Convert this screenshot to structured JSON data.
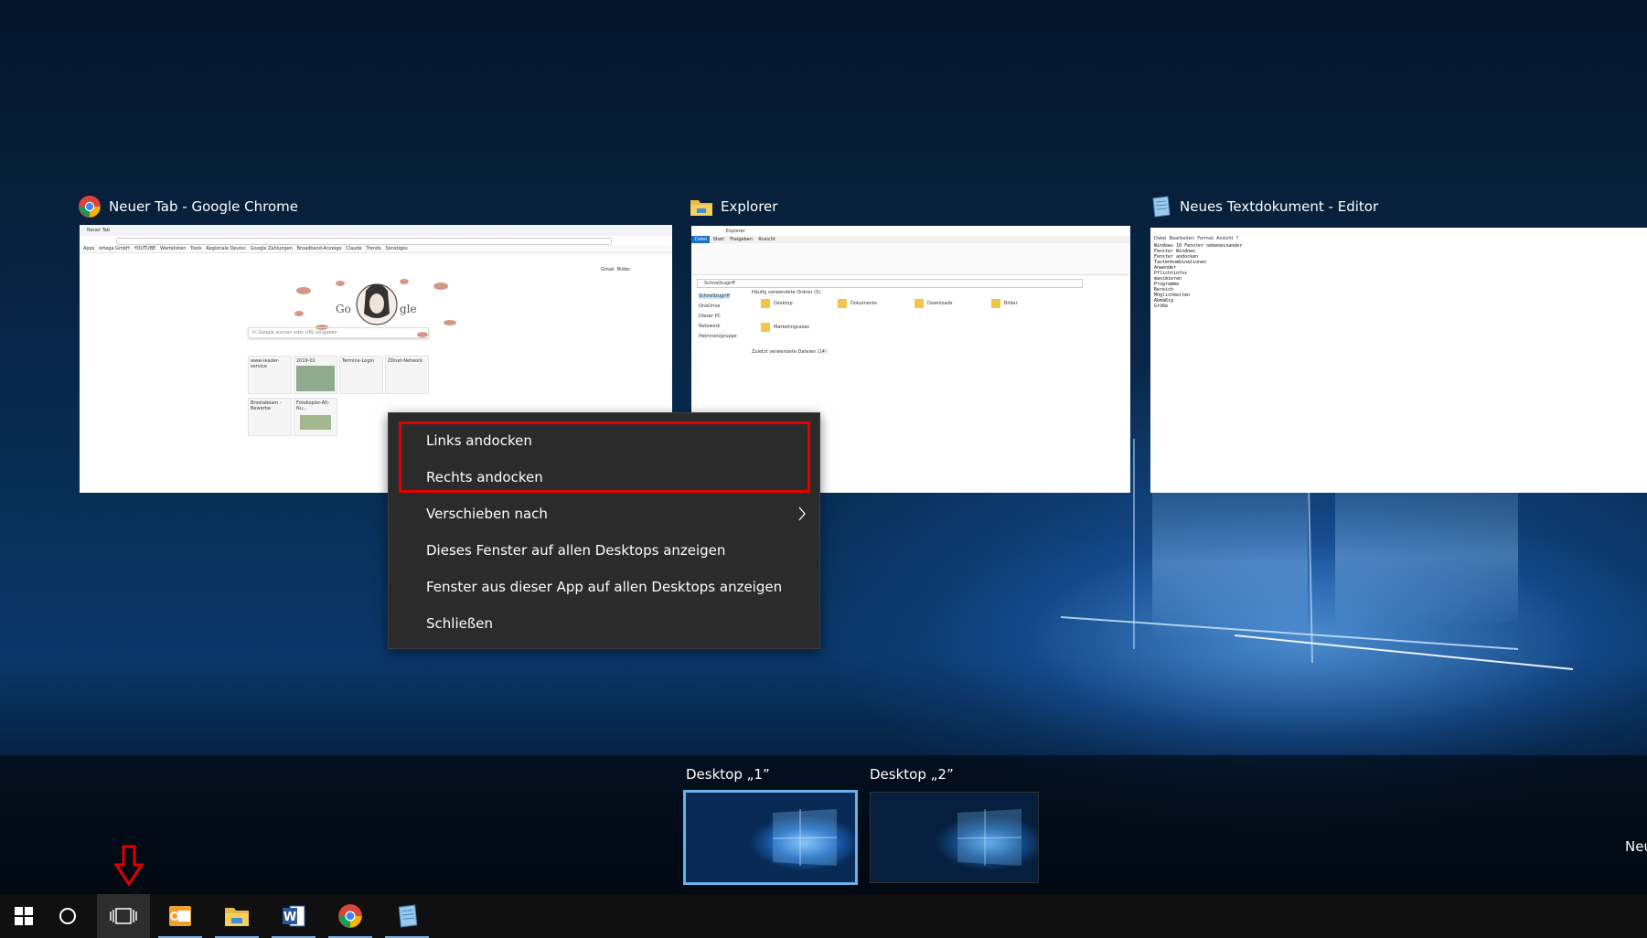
{
  "windows": [
    {
      "title": "Neuer Tab - Google Chrome",
      "icon": "chrome-icon"
    },
    {
      "title": "Explorer",
      "icon": "folder-icon"
    },
    {
      "title": "Neues Textdokument - Editor",
      "icon": "notepad-icon"
    }
  ],
  "chrome_thumb": {
    "tab": "Neuer Tab",
    "bookmarks": [
      "Apps",
      "ortega GmbH",
      "YOUTUBE",
      "Wartelisten",
      "Tools",
      "Regionale Deutsc",
      "Google Zahlungen",
      "Broadband-Anzeige",
      "Claude",
      "Trends",
      "Sonstiges"
    ],
    "header_links": [
      "Gmail",
      "Bilder"
    ],
    "search_placeholder": "In Google suchen oder URL eingeben",
    "tiles": [
      "www-leader-service",
      "2019-01",
      "Termine-Login",
      "ZDnet-Network",
      "Brostabeam - Bewerbe",
      "Fotokopier-Alt-Nu..."
    ]
  },
  "explorer_thumb": {
    "title": "Explorer",
    "ribbon_tabs": [
      "Datei",
      "Start",
      "Freigeben",
      "Ansicht"
    ],
    "address": "Schnellzugriff",
    "nav": [
      "Schnellzugriff",
      "OneDrive",
      "Dieser PC",
      "Netzwerk",
      "Heimnetzgruppe"
    ],
    "section1": "Häufig verwendete Ordner (5)",
    "folders": [
      "Desktop",
      "Dokumente",
      "Downloads",
      "Bilder",
      "Marketingcases"
    ],
    "section2": "Zuletzt verwendete Dateien (14)"
  },
  "notepad_thumb": {
    "menu": [
      "Datei",
      "Bearbeiten",
      "Format",
      "Ansicht",
      "?"
    ],
    "lines": [
      "Windows 10 Fenster nebeneinander",
      "Fenster Windows",
      "Fenster andocken",
      "Tastenkombinationen",
      "Anwender",
      "Pflichtinfos",
      "maximieren",
      "Programme",
      "Bereich",
      "Möglichkeiten",
      "Abmäßig",
      "Größe"
    ]
  },
  "context_menu": {
    "items": [
      {
        "label": "Links andocken"
      },
      {
        "label": "Rechts andocken"
      },
      {
        "label": "Verschieben nach",
        "submenu": true
      },
      {
        "label": "Dieses Fenster auf allen Desktops anzeigen"
      },
      {
        "label": "Fenster aus dieser App auf allen Desktops anzeigen"
      },
      {
        "label": "Schließen"
      }
    ],
    "highlight_color": "#e00000"
  },
  "desktops": [
    {
      "label": "Desktop „1”",
      "active": true
    },
    {
      "label": "Desktop „2”",
      "active": false
    }
  ],
  "new_desktop_label": "Neu",
  "taskbar": {
    "items": [
      "start-icon",
      "cortana-icon",
      "task-view-icon",
      "outlook-icon",
      "file-explorer-icon",
      "word-icon",
      "chrome-icon",
      "notepad-icon"
    ],
    "arrow_color": "#e00000"
  }
}
